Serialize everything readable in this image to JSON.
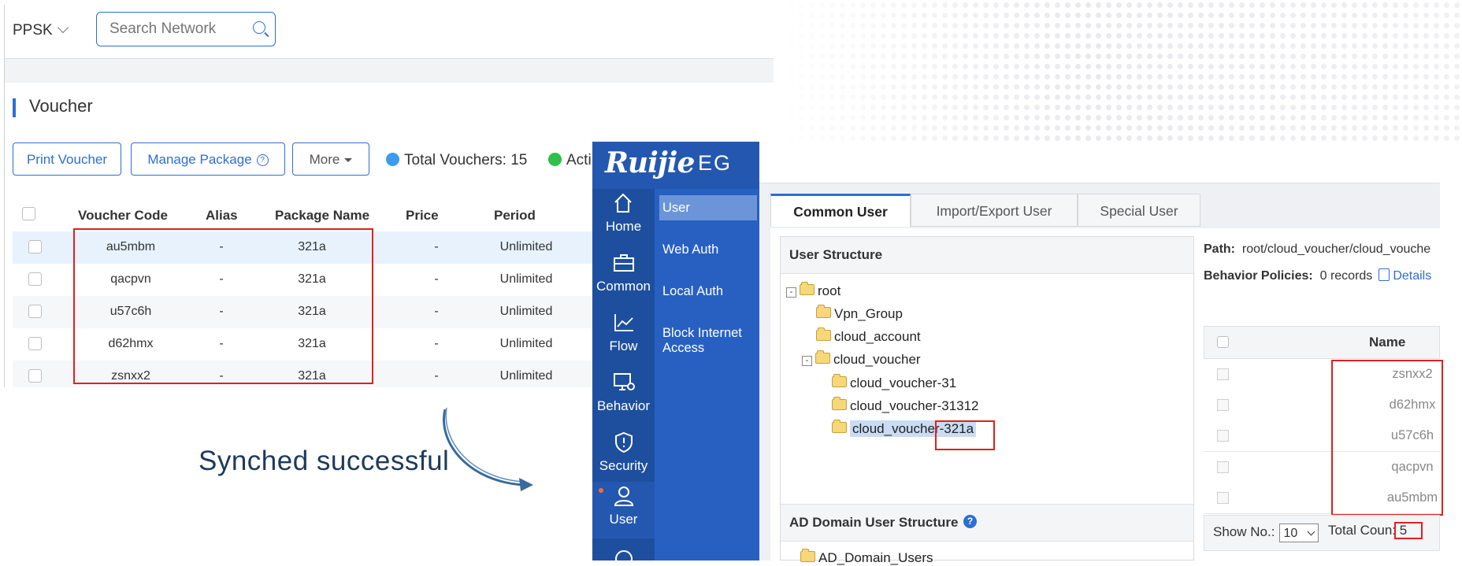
{
  "left_app": {
    "filter_label": "PPSK",
    "search_placeholder": "Search Network",
    "page_title": "Voucher",
    "buttons": {
      "print": "Print Voucher",
      "manage": "Manage Package",
      "more": "More"
    },
    "stats": {
      "total": "Total Vouchers: 15",
      "active": "Acti"
    },
    "columns": [
      "Voucher Code",
      "Alias",
      "Package Name",
      "Price",
      "Period"
    ],
    "rows": [
      {
        "code": "au5mbm",
        "alias": "-",
        "package": "321a",
        "price": "-",
        "period": "Unlimited"
      },
      {
        "code": "qacpvn",
        "alias": "-",
        "package": "321a",
        "price": "-",
        "period": "Unlimited"
      },
      {
        "code": "u57c6h",
        "alias": "-",
        "package": "321a",
        "price": "-",
        "period": "Unlimited"
      },
      {
        "code": "d62hmx",
        "alias": "-",
        "package": "321a",
        "price": "-",
        "period": "Unlimited"
      },
      {
        "code": "zsnxx2",
        "alias": "-",
        "package": "321a",
        "price": "-",
        "period": "Unlimited"
      }
    ],
    "colors": {
      "accent": "#2d6ed1",
      "stat_total": "#3b9cf0",
      "stat_active": "#2fbf4a"
    }
  },
  "annotation": {
    "text": "Synched successful"
  },
  "right_app": {
    "logo": "Ruijie",
    "product": "EG",
    "rail": [
      {
        "label": "Home",
        "icon": "home-icon"
      },
      {
        "label": "Common",
        "icon": "briefcase-icon"
      },
      {
        "label": "Flow",
        "icon": "chart-line-icon"
      },
      {
        "label": "Behavior",
        "icon": "monitor-settings-icon"
      },
      {
        "label": "Security",
        "icon": "shield-icon"
      },
      {
        "label": "User",
        "icon": "user-icon"
      }
    ],
    "submenu": [
      "User",
      "Web Auth",
      "Local Auth",
      "Block Internet Access"
    ],
    "tabs": [
      "Common User",
      "Import/Export User",
      "Special User"
    ],
    "user_structure_title": "User Structure",
    "tree": {
      "root": "root",
      "vpn": "Vpn_Group",
      "account": "cloud_account",
      "voucher": "cloud_voucher",
      "v31": "cloud_voucher-31",
      "v31312": "cloud_voucher-31312",
      "v321a": "cloud_voucher-321a"
    },
    "ad_title": "AD Domain User Structure",
    "ad_root": "AD_Domain_Users",
    "path_label": "Path:",
    "path_value": "root/cloud_voucher/cloud_vouche",
    "bp_label": "Behavior Policies:",
    "bp_value": "0 records",
    "details": "Details",
    "grid_name_header": "Name",
    "names": [
      "zsnxx2",
      "d62hmx",
      "u57c6h",
      "qacpvn",
      "au5mbm"
    ],
    "show_no_label": "Show No.:",
    "show_no_value": "10",
    "total_count_label": "Total Coun",
    "total_count_value": ": 5"
  }
}
